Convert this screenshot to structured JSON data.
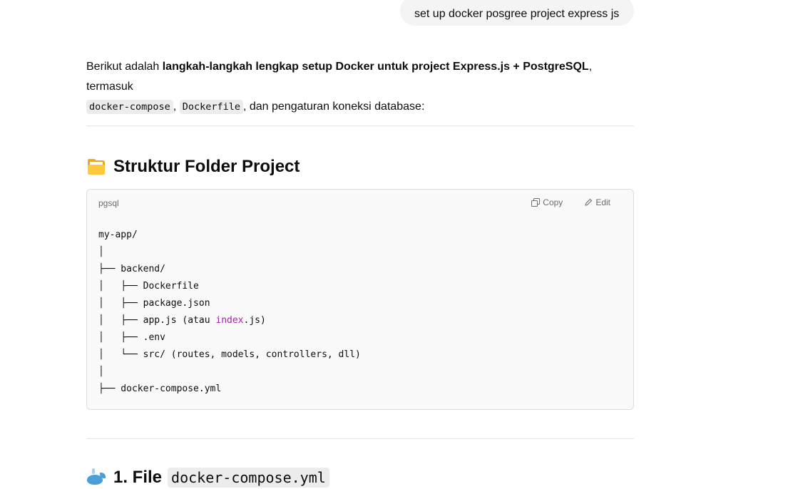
{
  "user_message": "set up docker posgree project express js",
  "intro": {
    "prefix": "Berikut adalah ",
    "bold": "langkah-langkah lengkap setup Docker untuk project Express.js + PostgreSQL",
    "suffix": ", termasuk",
    "code1": "docker-compose",
    "sep": ", ",
    "code2": "Dockerfile",
    "tail": ", dan pengaturan koneksi database:"
  },
  "section1": {
    "icon": "folder-icon",
    "title": "Struktur Folder Project"
  },
  "codeblock": {
    "language": "pgsql",
    "copy_label": "Copy",
    "edit_label": "Edit",
    "lines": [
      "my-app/",
      "│",
      "├── backend/",
      "│   ├── Dockerfile",
      "│   ├── package.json",
      "│   ├── app.js (atau ",
      "│   ├── .env",
      "│   └── src/ (routes, models, controllers, dll)",
      "│",
      "├── docker-compose.yml"
    ],
    "line6_keyword": "index",
    "line6_suffix": ".js)"
  },
  "section2": {
    "icon": "whale-icon",
    "title": "1. File",
    "code": "docker-compose.yml"
  }
}
